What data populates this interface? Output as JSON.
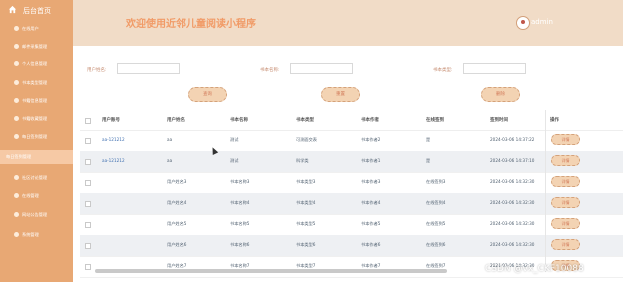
{
  "sidebar": {
    "brand": "后台首页",
    "items": [
      {
        "label": "在线用户"
      },
      {
        "label": "邮件采集管理"
      },
      {
        "label": "个人信息管理"
      },
      {
        "label": "书本类型管理"
      },
      {
        "label": "书籍信息管理"
      },
      {
        "label": "书籍收藏管理"
      },
      {
        "label": "每日签到管理"
      },
      {
        "label": "每日签到管理"
      },
      {
        "label": "社区讨论管理"
      },
      {
        "label": "在线管理"
      },
      {
        "label": "网站公告管理"
      },
      {
        "label": "系统管理"
      }
    ]
  },
  "header": {
    "title": "欢迎使用近邻儿童阅读小程序",
    "user": "admin"
  },
  "search": {
    "fields": [
      {
        "label": "用户姓名:",
        "value": ""
      },
      {
        "label": "书本名称:",
        "value": ""
      },
      {
        "label": "书本类型:",
        "value": ""
      }
    ],
    "buttons": [
      "查询",
      "重置",
      "删除"
    ]
  },
  "table": {
    "columns": [
      "用户账号",
      "用户姓名",
      "书本名称",
      "书本类型",
      "书本作者",
      "在线签到",
      "签到时间",
      "操作"
    ],
    "rows": [
      {
        "account": "aa-121212",
        "name": "aa",
        "book": "测试",
        "type": "可测面交表",
        "author": "书本作者2",
        "sign": "是",
        "time": "2024-03-06 14:37:22",
        "action": "详情"
      },
      {
        "account": "aa-121212",
        "name": "aa",
        "book": "测试",
        "type": "科学类",
        "author": "书本作者1",
        "sign": "是",
        "time": "2024-03-06 14:37:10",
        "action": "详情"
      },
      {
        "account": "",
        "name": "用户姓名3",
        "book": "书本名称3",
        "type": "书本类型3",
        "author": "书本作者3",
        "sign": "在线签到3",
        "time": "2024-03-06 14:32:30",
        "action": "详情"
      },
      {
        "account": "",
        "name": "用户姓名4",
        "book": "书本名称4",
        "type": "书本类型4",
        "author": "书本作者4",
        "sign": "在线签到4",
        "time": "2024-03-06 14:32:30",
        "action": "详情"
      },
      {
        "account": "",
        "name": "用户姓名5",
        "book": "书本名称5",
        "type": "书本类型5",
        "author": "书本作者5",
        "sign": "在线签到5",
        "time": "2024-03-06 14:32:30",
        "action": "详情"
      },
      {
        "account": "",
        "name": "用户姓名6",
        "book": "书本名称6",
        "type": "书本类型6",
        "author": "书本作者6",
        "sign": "在线签到6",
        "time": "2024-03-06 14:32:30",
        "action": "详情"
      },
      {
        "account": "",
        "name": "用户姓名7",
        "book": "书本名称7",
        "type": "书本类型7",
        "author": "书本作者7",
        "sign": "在线签到7",
        "time": "2024-03-06 14:32:30",
        "action": "详情"
      }
    ]
  },
  "watermark": "CSDN @vx_CKF10088"
}
